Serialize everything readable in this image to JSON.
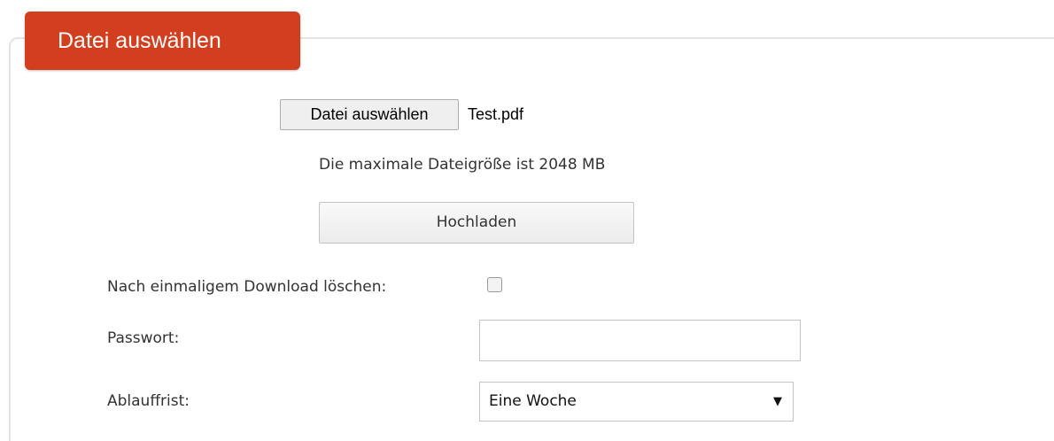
{
  "section": {
    "legend": "Datei auswählen"
  },
  "file_picker": {
    "button_label": "Datei auswählen",
    "selected_file": "Test.pdf"
  },
  "upload": {
    "max_size_text": "Die maximale Dateigröße ist 2048 MB",
    "button_label": "Hochladen"
  },
  "options": {
    "delete_after_download_label": "Nach einmaligem Download löschen:",
    "delete_after_download_checked": false,
    "password_label": "Passwort:",
    "password_value": "",
    "expiry_label": "Ablauffrist:",
    "expiry_selected": "Eine Woche",
    "expiry_arrow_icon": "dropdown-triangle-icon"
  },
  "colors": {
    "legend_background": "#d23f1e",
    "legend_text": "#ffffff",
    "border": "#e4e4e4"
  }
}
